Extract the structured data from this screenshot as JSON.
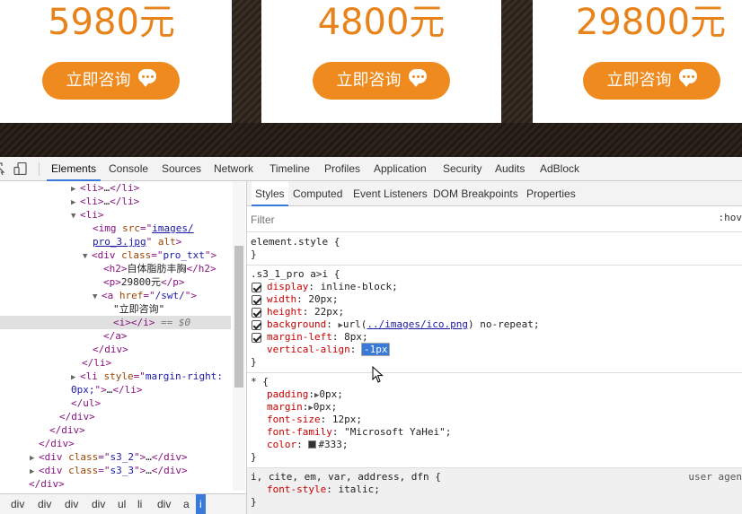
{
  "page": {
    "cards": [
      {
        "price": "5980元",
        "button_label": "立即咨询"
      },
      {
        "price": "4800元",
        "button_label": "立即咨询"
      },
      {
        "price": "29800元",
        "button_label": "立即咨询"
      }
    ],
    "accent_color": "#e8831a",
    "button_color": "#ee8a1e"
  },
  "devtools": {
    "toolbar_icons": [
      "inspect-icon",
      "device-mode-icon"
    ],
    "tabs": [
      "Elements",
      "Console",
      "Sources",
      "Network",
      "Timeline",
      "Profiles",
      "Application",
      "Security",
      "Audits",
      "AdBlock"
    ],
    "active_tab": "Elements",
    "tree": {
      "r1": {
        "open": "<li>",
        "ellipsis": "…",
        "close": "</li>"
      },
      "r2": {
        "open": "<li>",
        "ellipsis": "…",
        "close": "</li>"
      },
      "r3": {
        "open": "<li>"
      },
      "r4": {
        "tag": "<img ",
        "attr": "src",
        "eq": "=\"",
        "val": "images/"
      },
      "r5": {
        "val": "pro_3.jpg",
        "rest1": "\" ",
        "attr2": "alt",
        "end": ">"
      },
      "r6": {
        "tag": "<div ",
        "attr": "class",
        "eq": "=\"",
        "val": "pro_txt",
        "end": "\">"
      },
      "r7": {
        "open": "<h2>",
        "text": "自体脂肪丰胸",
        "close": "</h2>"
      },
      "r8": {
        "open": "<p>",
        "text": "29800元",
        "close": "</p>"
      },
      "r9": {
        "tag": "<a ",
        "attr": "href",
        "eq": "=\"",
        "val": "/swt/",
        "end": "\">"
      },
      "r10": {
        "text": "\"立即咨询\""
      },
      "r11": {
        "open": "<i>",
        "close": "</i>",
        "marker": " == $0"
      },
      "r12": {
        "close": "</a>"
      },
      "r13": {
        "close": "</div>"
      },
      "r14": {
        "close": "</li>"
      },
      "r15": {
        "tag": "<li ",
        "attr": "style",
        "eq": "=\"",
        "val": "margin-right:"
      },
      "r16": {
        "val": "0px;",
        "end": "\">",
        "ellipsis": "…",
        "close": "</li>"
      },
      "r17": {
        "close": "</ul>"
      },
      "r18": {
        "close": "</div>"
      },
      "r19": {
        "close": "</div>"
      },
      "r20": {
        "close": "</div>"
      },
      "r21": {
        "tag": "<div ",
        "attr": "class",
        "eq": "=\"",
        "val": "s3_2",
        "end": "\">",
        "ellipsis": "…",
        "close": "</div>"
      },
      "r22": {
        "tag": "<div ",
        "attr": "class",
        "eq": "=\"",
        "val": "s3_3",
        "end": "\">",
        "ellipsis": "…",
        "close": "</div>"
      },
      "r23": {
        "close": "</div>"
      }
    },
    "breadcrumbs": [
      "div",
      "div",
      "div",
      "div",
      "ul",
      "li",
      "div",
      "a",
      "i"
    ],
    "active_breadcrumb": "i",
    "style_tabs": [
      "Styles",
      "Computed",
      "Event Listeners",
      "DOM Breakpoints",
      "Properties"
    ],
    "active_style_tab": "Styles",
    "filter_placeholder": "Filter",
    "hov_label": ":hov",
    "element_style": {
      "selector": "element.style {",
      "close": "}"
    },
    "rule1": {
      "selector": ".s3_1_pro a>i {",
      "props": [
        {
          "name": "display",
          "value": "inline-block;"
        },
        {
          "name": "width",
          "value": "20px;"
        },
        {
          "name": "height",
          "value": "22px;"
        },
        {
          "name": "background",
          "value_prefix": "url(",
          "link": "../images/ico.png",
          "value_suffix": ") no-repeat;"
        },
        {
          "name": "margin-left",
          "value": "8px;"
        }
      ],
      "editing_prop": {
        "name": "vertical-align",
        "value": "-1px"
      },
      "close": "}"
    },
    "rule2": {
      "selector": "* {",
      "props": [
        {
          "name": "padding",
          "value": "0px;"
        },
        {
          "name": "margin",
          "value": "0px;"
        },
        {
          "name": "font-size",
          "value": "12px;"
        },
        {
          "name": "font-family",
          "value": "\"Microsoft YaHei\";"
        },
        {
          "name": "color",
          "value": "#333;"
        }
      ],
      "close": "}"
    },
    "rule3": {
      "selector": "i, cite, em, var, address, dfn {",
      "origin": "user agen",
      "props": [
        {
          "name": "font-style",
          "value": "italic;"
        }
      ],
      "close": "}"
    }
  }
}
